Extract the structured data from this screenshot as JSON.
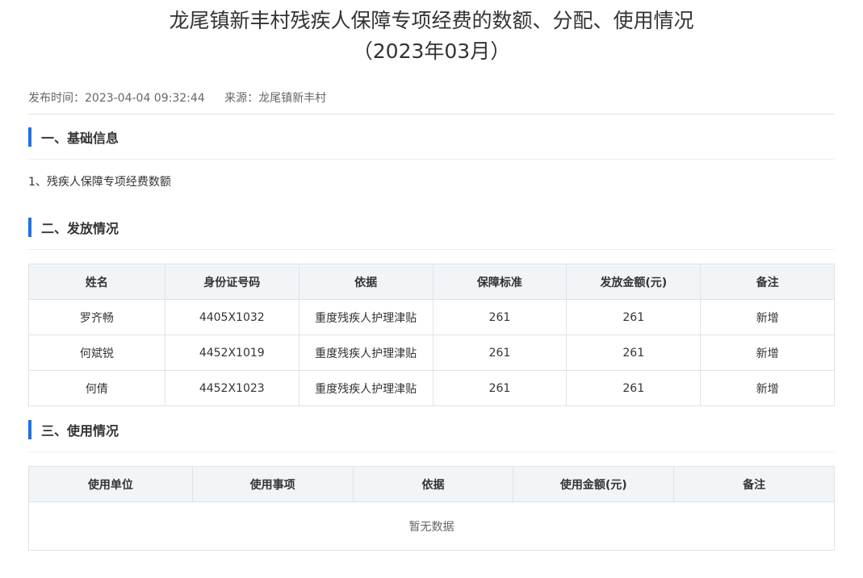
{
  "title_line1": "龙尾镇新丰村残疾人保障专项经费的数额、分配、使用情况",
  "title_line2": "（2023年03月）",
  "meta": {
    "publish_time": "发布时间：2023-04-04 09:32:44",
    "source": "来源：龙尾镇新丰村"
  },
  "sections": {
    "basic": "一、基础信息",
    "distribution": "二、发放情况",
    "usage": "三、使用情况"
  },
  "basic_text": "1、残疾人保障专项经费数额",
  "distribution_table": {
    "headers": [
      "姓名",
      "身份证号码",
      "依据",
      "保障标准",
      "发放金额(元)",
      "备注"
    ],
    "rows": [
      [
        "罗齐畅",
        "4405X1032",
        "重度残疾人护理津贴",
        "261",
        "261",
        "新增"
      ],
      [
        "何斌锐",
        "4452X1019",
        "重度残疾人护理津贴",
        "261",
        "261",
        "新增"
      ],
      [
        "何倩",
        "4452X1023",
        "重度残疾人护理津贴",
        "261",
        "261",
        "新增"
      ]
    ]
  },
  "usage_table": {
    "headers": [
      "使用单位",
      "使用事项",
      "依据",
      "使用金额(元)",
      "备注"
    ],
    "empty_text": "暂无数据"
  },
  "colors": {
    "accent": "#1a73e8",
    "header_bg": "#f2f5f8",
    "border": "#dfe3e8"
  }
}
